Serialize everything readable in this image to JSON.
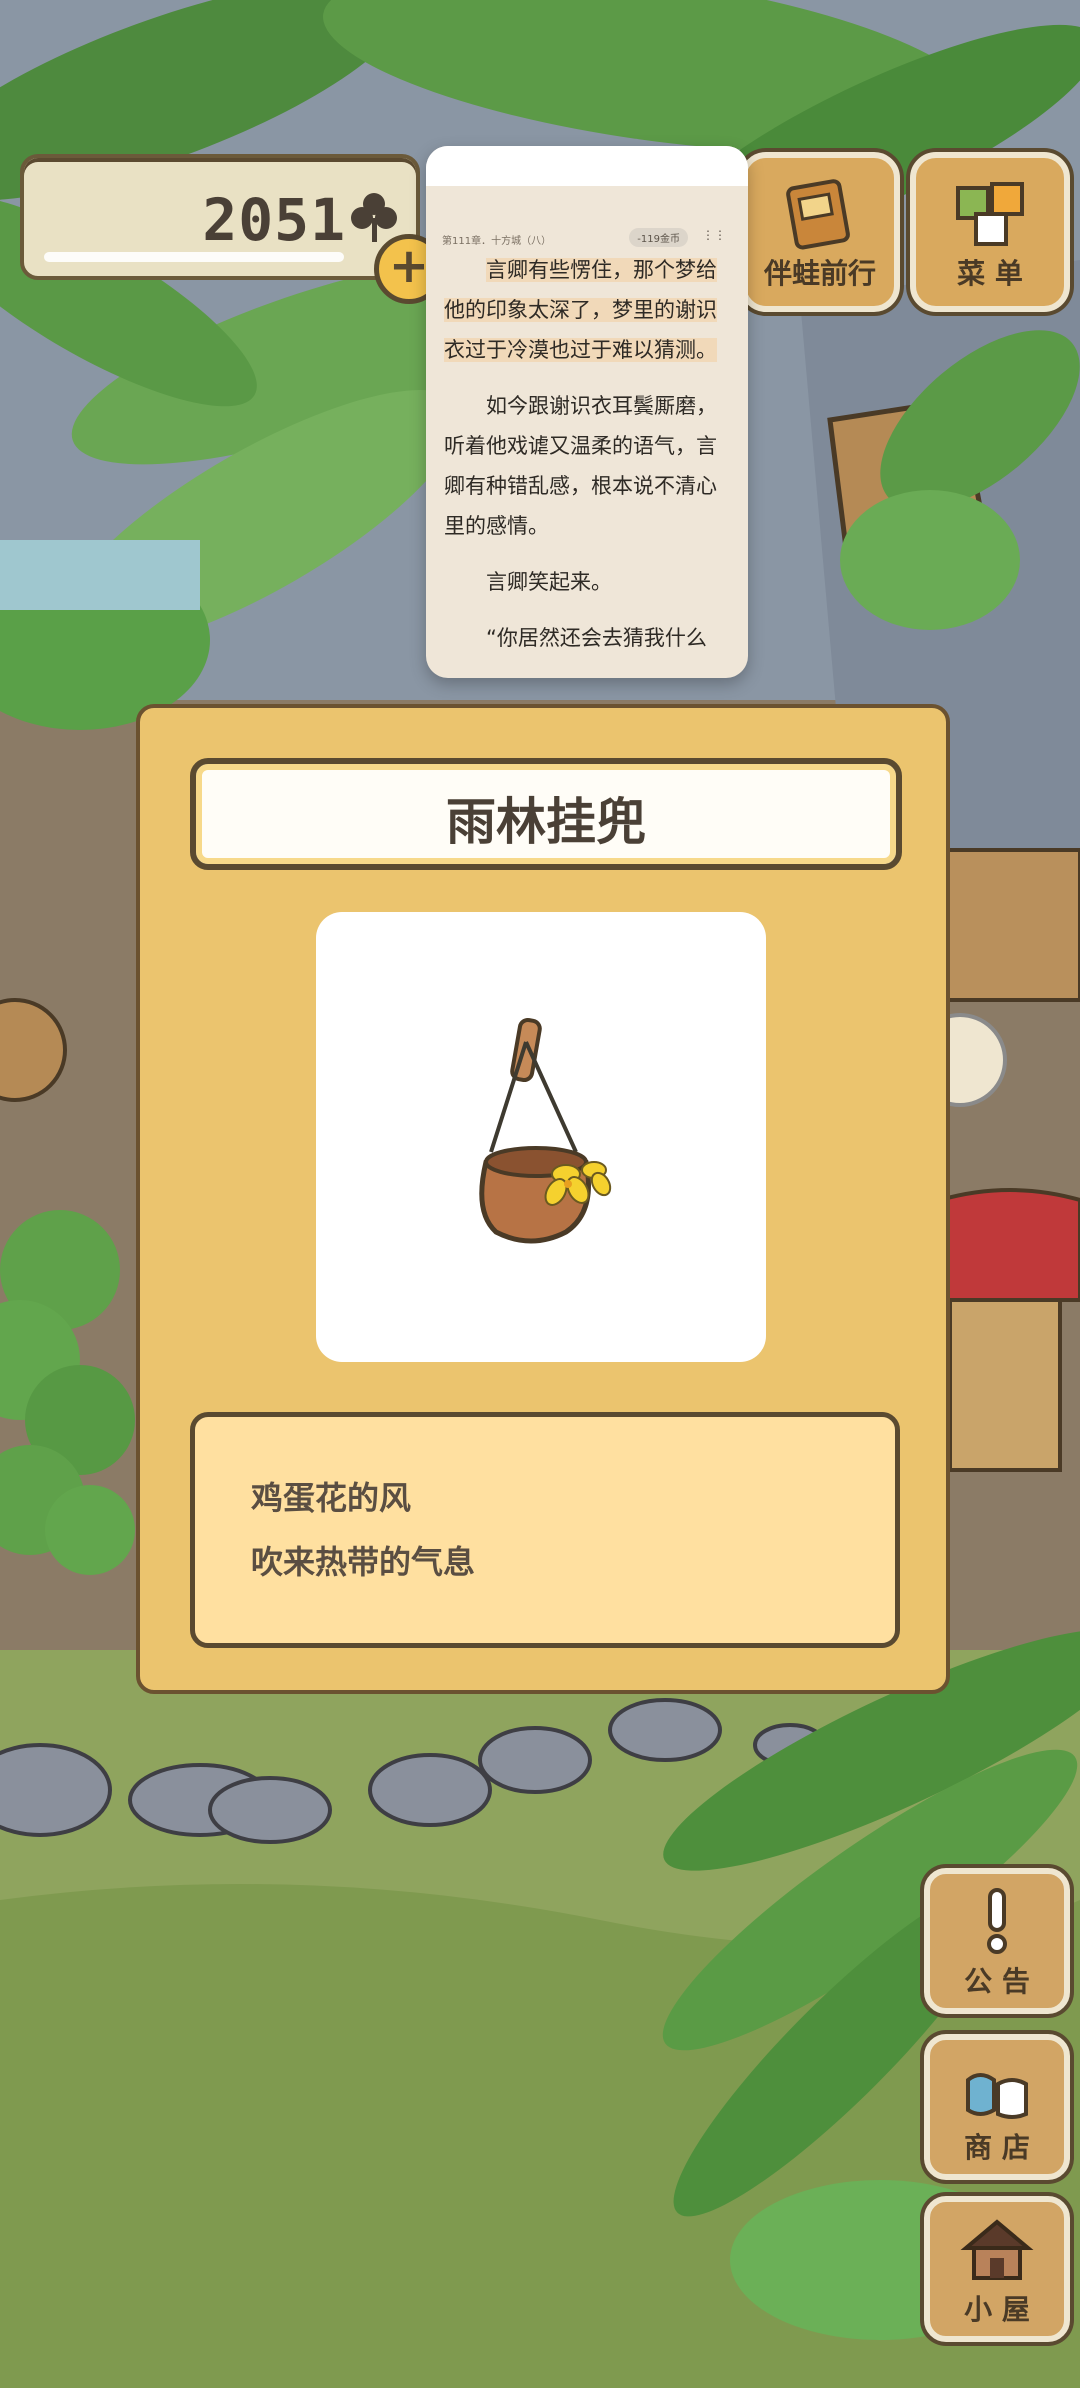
{
  "hud": {
    "clover_count": "2051",
    "add_label": "+"
  },
  "top_buttons": {
    "frog_trip_label": "伴蛙前行",
    "menu_label": "菜 单"
  },
  "reader_overlay": {
    "chapter": "第111章．十方城（八）",
    "pill": "-119金币",
    "paragraphs": [
      "言卿有些愣住，那个梦给他的印象太深了，梦里的谢识衣过于冷漠也过于难以猜测。",
      "如今跟谢识衣耳鬓厮磨，听着他戏谑又温柔的语气，言卿有种错乱感，根本说不清心里的感情。",
      "言卿笑起来。",
      "“你居然还会去猜我什么"
    ]
  },
  "item_card": {
    "title": "雨林挂兜",
    "description_line1": "鸡蛋花的风",
    "description_line2": "吹来热带的气息",
    "image_icon": "coconut-hanging-basket-icon"
  },
  "side_buttons": {
    "notice_label": "公 告",
    "shop_label": "商 店",
    "house_label": "小 屋"
  },
  "colors": {
    "card_bg": "#ebc46e",
    "desc_bg": "#ffe0a0",
    "outline": "#5a4a30"
  }
}
